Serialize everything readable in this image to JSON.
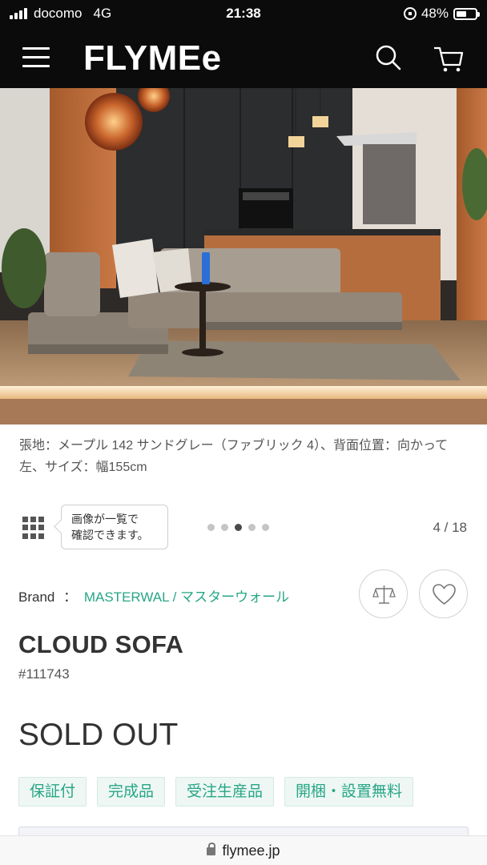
{
  "status_bar": {
    "carrier": "docomo",
    "network": "4G",
    "time": "21:38",
    "battery": "48%",
    "battery_level": 0.48
  },
  "header": {
    "logo": "FLYMEe",
    "menu_icon": "hamburger-menu-icon",
    "search_icon": "search-icon",
    "cart_icon": "cart-icon",
    "background": "#0b0b0b"
  },
  "gallery": {
    "caption": "張地：メープル 142 サンドグレー（ファブリック 4）、背面位置：向かって左、サイズ：幅155cm",
    "tooltip_line1": "画像が一覧で",
    "tooltip_line2": "確認できます。",
    "dots_total": 5,
    "dots_active_index": 2,
    "counter": "4 / 18"
  },
  "product": {
    "brand_label": "Brand",
    "brand_sep": "：",
    "brand_name": "MASTERWAL / マスターウォール",
    "name": "CLOUD SOFA",
    "id": "#111743",
    "status": "SOLD OUT",
    "tags": [
      "保証付",
      "完成品",
      "受注生産品",
      "開梱・設置無料"
    ],
    "accent_color": "#27a685"
  },
  "browser": {
    "url": "flymee.jp"
  }
}
